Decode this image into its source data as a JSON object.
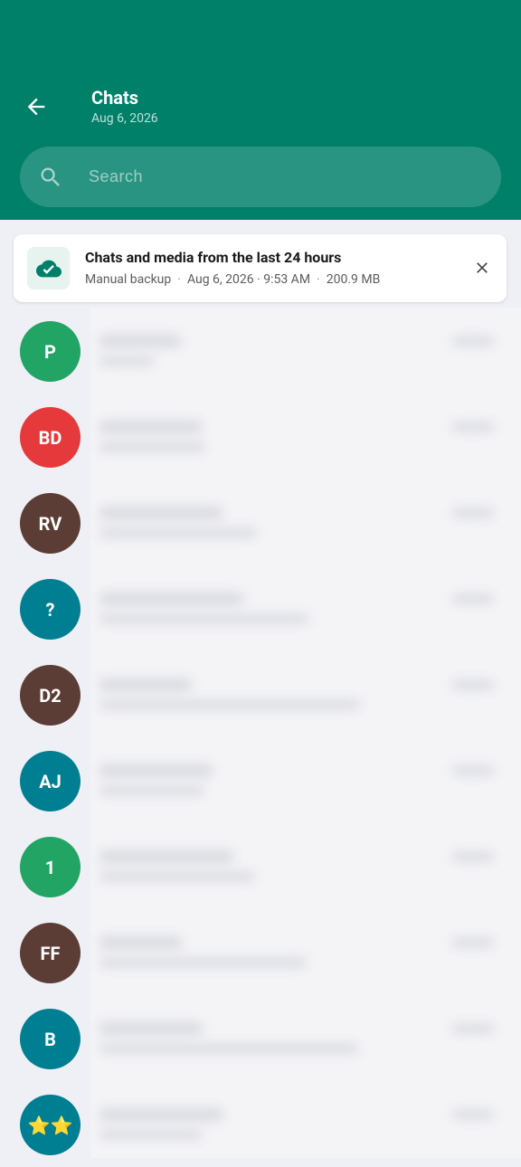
{
  "header": {
    "title": "Chats",
    "subtitle": "Aug 6, 2026",
    "back_icon": "arrow-left-icon"
  },
  "search": {
    "placeholder": "Search",
    "icon": "search-icon"
  },
  "backup_card": {
    "title": "Chats and media from the last 24 hours",
    "type": "Manual backup",
    "datetime": "Aug 6, 2026 · 9:53 AM",
    "size": "200.9 MB",
    "icon": "cloud-check-icon",
    "close_icon": "close-icon"
  },
  "chats": [
    {
      "initials": "P",
      "color": "#21a464"
    },
    {
      "initials": "BD",
      "color": "#e5393b"
    },
    {
      "initials": "RV",
      "color": "#5c3d35"
    },
    {
      "initials": "?",
      "color": "#007f92"
    },
    {
      "initials": "D2",
      "color": "#5c3d35"
    },
    {
      "initials": "AJ",
      "color": "#007f92"
    },
    {
      "initials": "1",
      "color": "#21a464"
    },
    {
      "initials": "FF",
      "color": "#5c3d35"
    },
    {
      "initials": "B",
      "color": "#007f92"
    },
    {
      "initials": "⭐⭐",
      "color": "#007f92"
    }
  ],
  "colors": {
    "header_bg": "#008069",
    "page_bg": "#eff0f5"
  }
}
